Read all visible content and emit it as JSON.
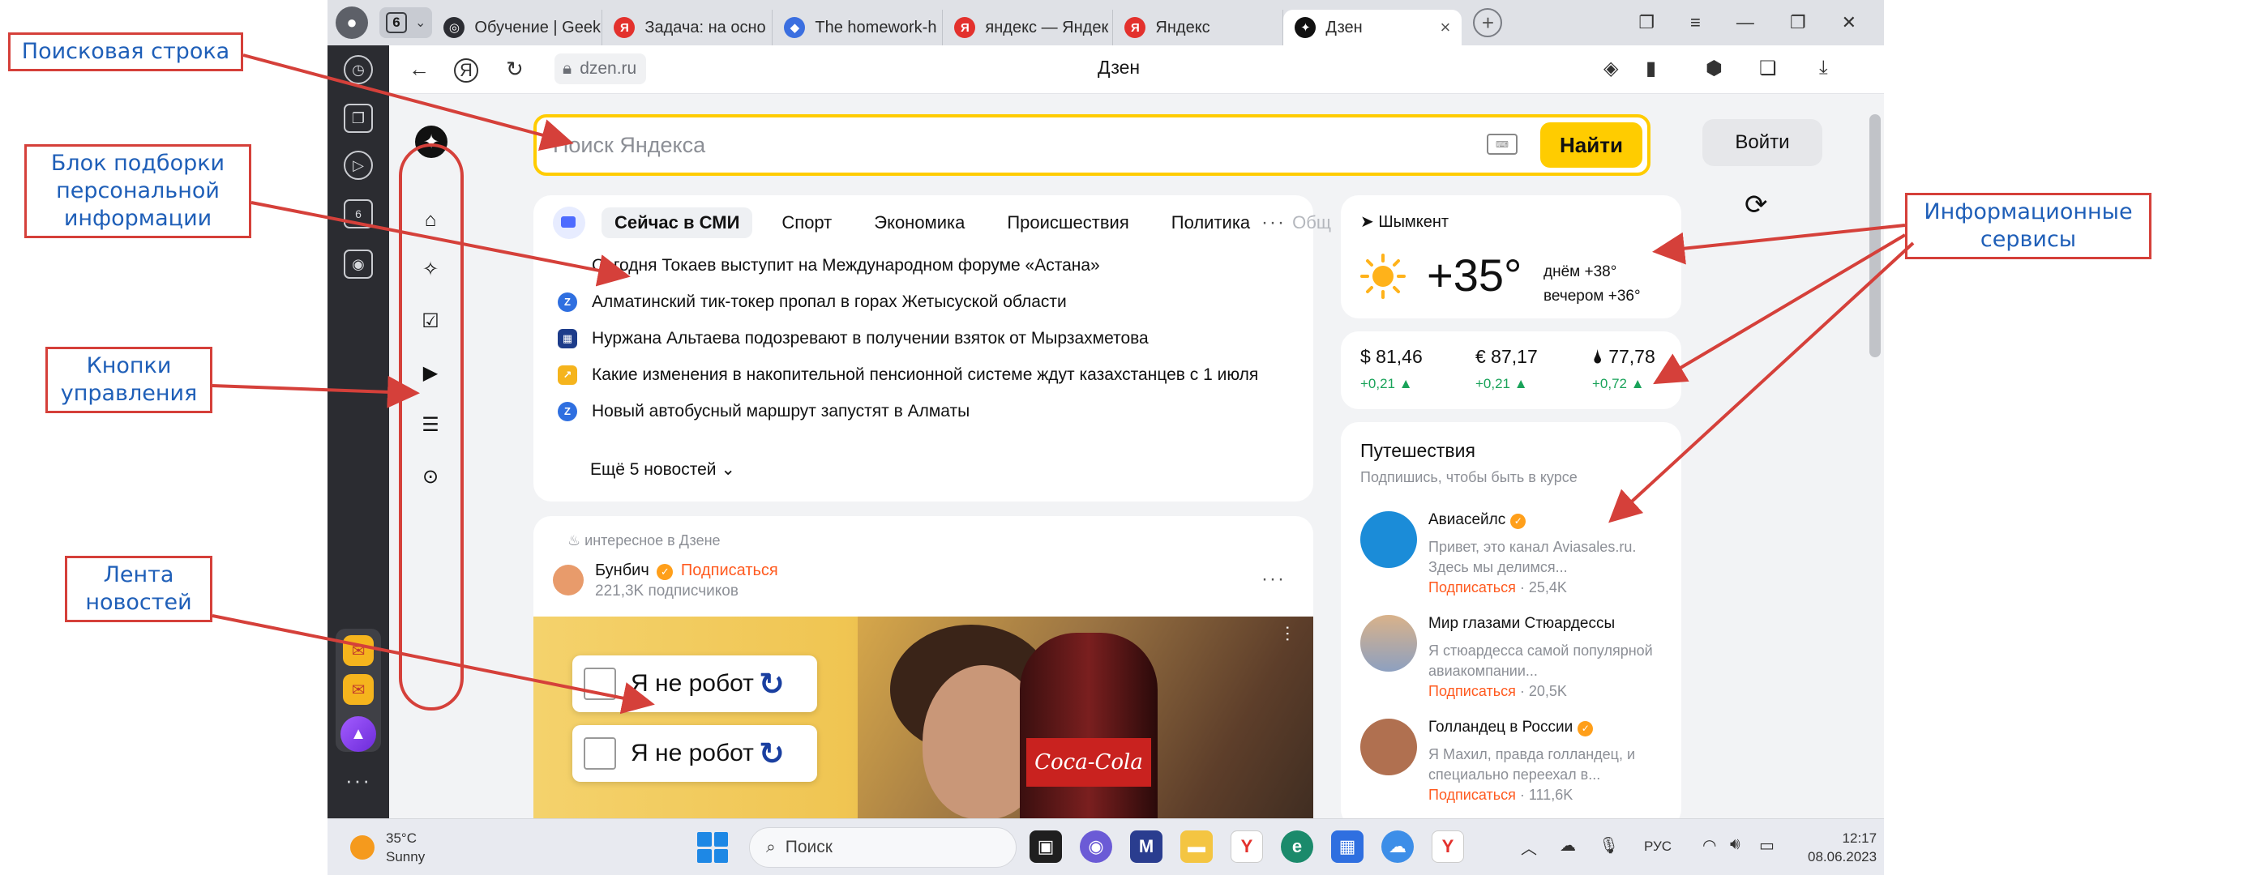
{
  "annotations": {
    "search_bar": "Поисковая строка",
    "personal_block": [
      "Блок подборки",
      "персональной",
      "информации"
    ],
    "control_buttons": [
      "Кнопки",
      "управления"
    ],
    "news_feed": [
      "Лента",
      "новостей"
    ],
    "info_services": [
      "Информационные",
      "сервисы"
    ]
  },
  "browser": {
    "tab_count": "6",
    "tabs": [
      {
        "title": "Обучение | Geek",
        "icon": "geekbrains-icon",
        "color": "#2c2d33"
      },
      {
        "title": "Задача: на осно",
        "icon": "yandex-icon",
        "color": "#e3312d"
      },
      {
        "title": "The homework-h",
        "icon": "shield-icon",
        "color": "#3b6fe0"
      },
      {
        "title": "яндекс — Яндек",
        "icon": "yandex-icon",
        "color": "#e3312d"
      },
      {
        "title": "Яндекс",
        "icon": "yandex-icon",
        "color": "#e3312d"
      },
      {
        "title": "Дзен",
        "icon": "dzen-icon",
        "color": "#111111",
        "active": true
      }
    ],
    "url": "dzen.ru",
    "page_title": "Дзен"
  },
  "search": {
    "placeholder": "Поиск Яндекса",
    "button": "Найти",
    "login": "Войти"
  },
  "news": {
    "tabs": [
      "Сейчас в СМИ",
      "Спорт",
      "Экономика",
      "Происшествия",
      "Политика",
      "Общ"
    ],
    "items": [
      {
        "text": "Сегодня Токаев выступит на Международном форуме «Астана»",
        "color": "#ffffff",
        "glyph": ""
      },
      {
        "text": "Алматинский тик-токер пропал в горах Жетысуской области",
        "color": "#2f6fe0",
        "glyph": "Z"
      },
      {
        "text": "Нуржана Альтаева подозревают в получении взяток от Мырзахметова",
        "color": "#1d3c8a",
        "glyph": "▦"
      },
      {
        "text": "Какие изменения в накопительной пенсионной системе ждут казахстанцев с 1 июля",
        "color": "#f5b41d",
        "glyph": "↗"
      },
      {
        "text": "Новый автобусный маршрут запустят в Алматы",
        "color": "#2f6fe0",
        "glyph": "Z"
      }
    ],
    "show_more": "Ещё 5 новостей"
  },
  "post": {
    "source": "интересное в Дзене",
    "author": "Бунбич",
    "subscribe": "Подписаться",
    "subscribers": "221,3K подписчиков",
    "captcha_text": "Я не робот",
    "brand": "Coca-Cola"
  },
  "weather": {
    "city": "Шымкент",
    "temp": "+35°",
    "day": "днём +38°",
    "evening": "вечером +36°"
  },
  "rates": [
    {
      "label": "$ 81,46",
      "change": "+0,21 ▲"
    },
    {
      "label": "€ 87,17",
      "change": "+0,21 ▲"
    },
    {
      "label": "🌢 77,78",
      "change": "+0,72 ▲"
    }
  ],
  "travel": {
    "title": "Путешествия",
    "subtitle": "Подпишись, чтобы быть в курсе",
    "channels": [
      {
        "name": "Авиасейлс",
        "verified": true,
        "desc": "Привет, это канал Aviasales.ru. Здесь мы делимся...",
        "subscribe": "Подписаться",
        "count": " · 25,4K",
        "color": "#1b8cd8"
      },
      {
        "name": "Мир глазами Стюардессы",
        "verified": false,
        "desc": "Я стюардесса самой популярной авиакомпании...",
        "subscribe": "Подписаться",
        "count": " · 20,5K",
        "color": "#9aa8c0"
      },
      {
        "name": "Голландец в России",
        "verified": true,
        "desc": "Я Махил, правда голландец, и специально переехал в...",
        "subscribe": "Подписаться",
        "count": " · 111,6K",
        "color": "#b07050"
      }
    ]
  },
  "taskbar": {
    "weather_temp": "35°C",
    "weather_desc": "Sunny",
    "search": "Поиск",
    "lang": "РУС",
    "time": "12:17",
    "date": "08.06.2023"
  }
}
